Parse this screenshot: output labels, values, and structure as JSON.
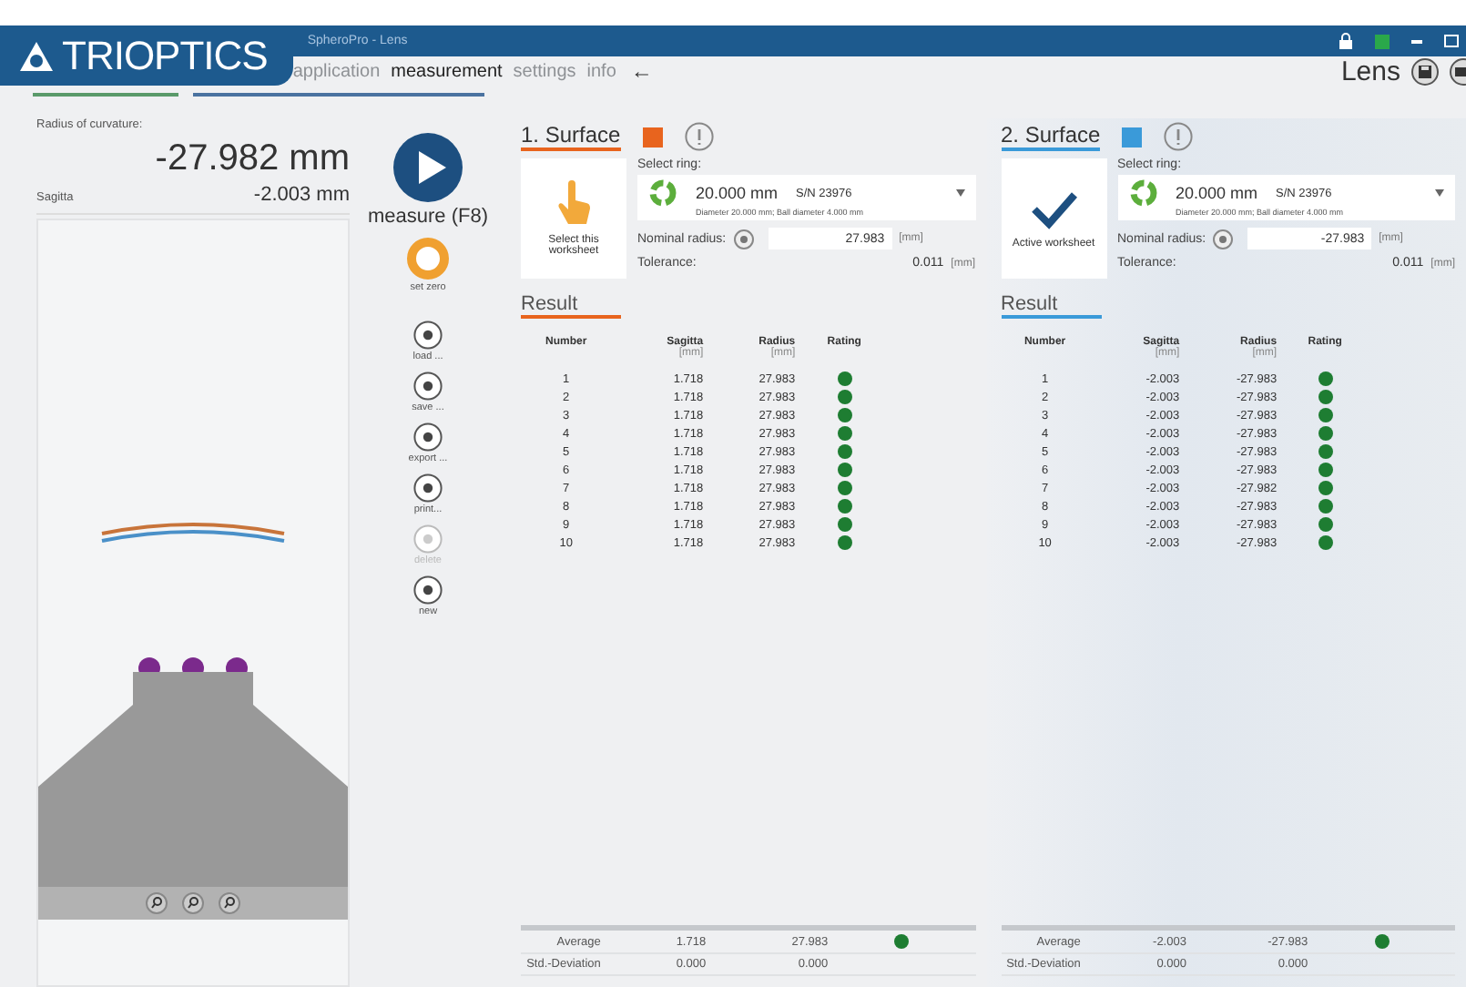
{
  "window": {
    "logo": "TRIOPTICS",
    "title": "SpheroPro - Lens"
  },
  "tabs": [
    {
      "label": "application",
      "selected": false,
      "disabled": true
    },
    {
      "label": "measurement",
      "selected": true,
      "disabled": false
    },
    {
      "label": "settings",
      "selected": false,
      "disabled": true
    },
    {
      "label": "info",
      "selected": false,
      "disabled": true
    }
  ],
  "back_arrow": "←",
  "mode": {
    "label": "Lens"
  },
  "readout": {
    "radius_label": "Radius of curvature:",
    "radius_value": "-27.982 mm",
    "sagitta_label": "Sagitta",
    "sagitta_value": "-2.003 mm"
  },
  "measure": {
    "label": "measure (F8)"
  },
  "set_zero": {
    "label": "set zero"
  },
  "tools": [
    {
      "label": "load ...",
      "disabled": false
    },
    {
      "label": "save ...",
      "disabled": false
    },
    {
      "label": "export ...",
      "disabled": false
    },
    {
      "label": "print...",
      "disabled": false
    },
    {
      "label": "delete",
      "disabled": true
    },
    {
      "label": "new",
      "disabled": false
    }
  ],
  "surfaces": [
    {
      "title": "1. Surface",
      "color": "#e8641e",
      "selected": false,
      "worksheet_label": "Select this worksheet",
      "ring_label": "Select ring:",
      "ring_value": "20.000 mm",
      "ring_sn": "S/N 23976",
      "ring_detail": "Diameter 20.000 mm; Ball diameter 4.000 mm",
      "nominal_label": "Nominal radius:",
      "nominal_value": "27.983",
      "nominal_unit": "[mm]",
      "tolerance_label": "Tolerance:",
      "tolerance_value": "0.011",
      "tolerance_unit": "[mm]",
      "result_title": "Result",
      "columns": [
        {
          "name": "Number"
        },
        {
          "name": "Sagitta",
          "unit": "[mm]"
        },
        {
          "name": "Radius",
          "unit": "[mm]"
        },
        {
          "name": "Rating"
        }
      ],
      "rows": [
        {
          "number": "1",
          "sagitta": "1.718",
          "radius": "27.983",
          "color": "#1e7d32"
        },
        {
          "number": "2",
          "sagitta": "1.718",
          "radius": "27.983",
          "color": "#1e7d32"
        },
        {
          "number": "3",
          "sagitta": "1.718",
          "radius": "27.983",
          "color": "#1e7d32"
        },
        {
          "number": "4",
          "sagitta": "1.718",
          "radius": "27.983",
          "color": "#1e7d32"
        },
        {
          "number": "5",
          "sagitta": "1.718",
          "radius": "27.983",
          "color": "#1e7d32"
        },
        {
          "number": "6",
          "sagitta": "1.718",
          "radius": "27.983",
          "color": "#1e7d32"
        },
        {
          "number": "7",
          "sagitta": "1.718",
          "radius": "27.983",
          "color": "#1e7d32"
        },
        {
          "number": "8",
          "sagitta": "1.718",
          "radius": "27.983",
          "color": "#1e7d32"
        },
        {
          "number": "9",
          "sagitta": "1.718",
          "radius": "27.983",
          "color": "#1e7d32"
        },
        {
          "number": "10",
          "sagitta": "1.718",
          "radius": "27.983",
          "color": "#1e7d32"
        }
      ],
      "average": {
        "label": "Average",
        "sagitta": "1.718",
        "radius": "27.983",
        "color": "#1e7d32"
      },
      "std_dev": {
        "label": "Std.-Deviation",
        "sagitta": "0.000",
        "radius": "0.000"
      }
    },
    {
      "title": "2. Surface",
      "color": "#3a9ad9",
      "selected": true,
      "worksheet_label": "Active worksheet",
      "ring_label": "Select ring:",
      "ring_value": "20.000 mm",
      "ring_sn": "S/N 23976",
      "ring_detail": "Diameter 20.000 mm; Ball diameter 4.000 mm",
      "nominal_label": "Nominal radius:",
      "nominal_value": "-27.983",
      "nominal_unit": "[mm]",
      "tolerance_label": "Tolerance:",
      "tolerance_value": "0.011",
      "tolerance_unit": "[mm]",
      "result_title": "Result",
      "columns": [
        {
          "name": "Number"
        },
        {
          "name": "Sagitta",
          "unit": "[mm]"
        },
        {
          "name": "Radius",
          "unit": "[mm]"
        },
        {
          "name": "Rating"
        }
      ],
      "rows": [
        {
          "number": "1",
          "sagitta": "-2.003",
          "radius": "-27.983",
          "color": "#1e7d32"
        },
        {
          "number": "2",
          "sagitta": "-2.003",
          "radius": "-27.983",
          "color": "#1e7d32"
        },
        {
          "number": "3",
          "sagitta": "-2.003",
          "radius": "-27.983",
          "color": "#1e7d32"
        },
        {
          "number": "4",
          "sagitta": "-2.003",
          "radius": "-27.983",
          "color": "#1e7d32"
        },
        {
          "number": "5",
          "sagitta": "-2.003",
          "radius": "-27.983",
          "color": "#1e7d32"
        },
        {
          "number": "6",
          "sagitta": "-2.003",
          "radius": "-27.983",
          "color": "#1e7d32"
        },
        {
          "number": "7",
          "sagitta": "-2.003",
          "radius": "-27.982",
          "color": "#1e7d32"
        },
        {
          "number": "8",
          "sagitta": "-2.003",
          "radius": "-27.983",
          "color": "#1e7d32"
        },
        {
          "number": "9",
          "sagitta": "-2.003",
          "radius": "-27.983",
          "color": "#1e7d32"
        },
        {
          "number": "10",
          "sagitta": "-2.003",
          "radius": "-27.983",
          "color": "#1e7d32"
        }
      ],
      "average": {
        "label": "Average",
        "sagitta": "-2.003",
        "radius": "-27.983",
        "color": "#1e7d32"
      },
      "std_dev": {
        "label": "Std.-Deviation",
        "sagitta": "0.000",
        "radius": "0.000"
      }
    }
  ]
}
